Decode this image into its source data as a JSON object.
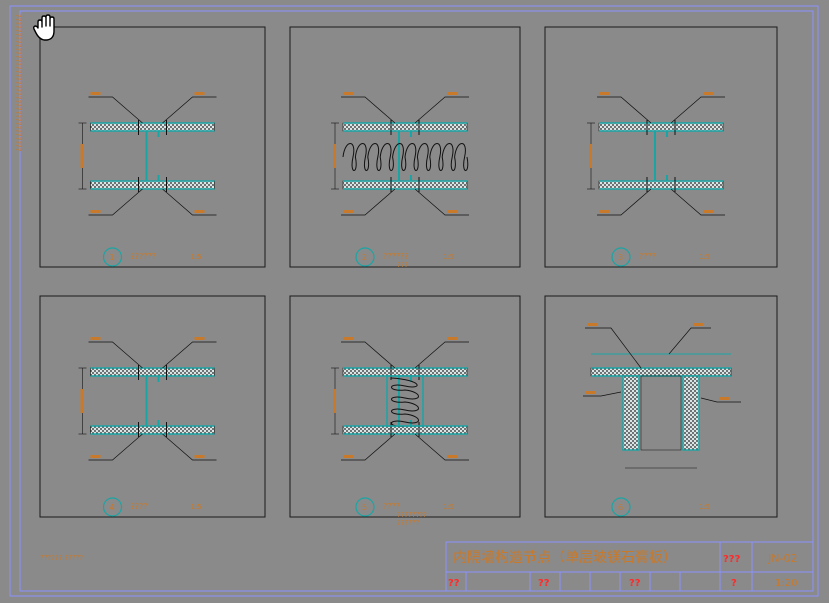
{
  "colors": {
    "background": "#8a8a8a",
    "frame_blue": "#8a93ff",
    "frame_dark": "#1a1a1a",
    "wall": "#1aa5a5",
    "annotation": "#c8792a",
    "question_marks": "#ff2a2a"
  },
  "title_block": {
    "title": "内隔墙构造节点（单层玻镁石膏板）",
    "drawing_no": "JN-02",
    "scale": "1:20",
    "q_design": "???",
    "q1": "??",
    "q2": "??",
    "q3": "??",
    "q4": "?"
  },
  "note_left": "??????.?????",
  "side_notes": "?????????????????????????????????????",
  "details": [
    {
      "id": "1",
      "label": "??????",
      "scale": "1:5"
    },
    {
      "id": "2",
      "label": "??????",
      "sub": "???",
      "scale": "1:5"
    },
    {
      "id": "3",
      "label": "????",
      "scale": "1:5"
    },
    {
      "id": "4",
      "label": "????",
      "scale": "1:5"
    },
    {
      "id": "5",
      "label": "????",
      "sub": "????????",
      "sub2": "??????",
      "scale": "1:5"
    },
    {
      "id": "6",
      "label": "",
      "scale": "1:5"
    }
  ],
  "icons": {
    "cursor": "hand-grab-icon"
  }
}
